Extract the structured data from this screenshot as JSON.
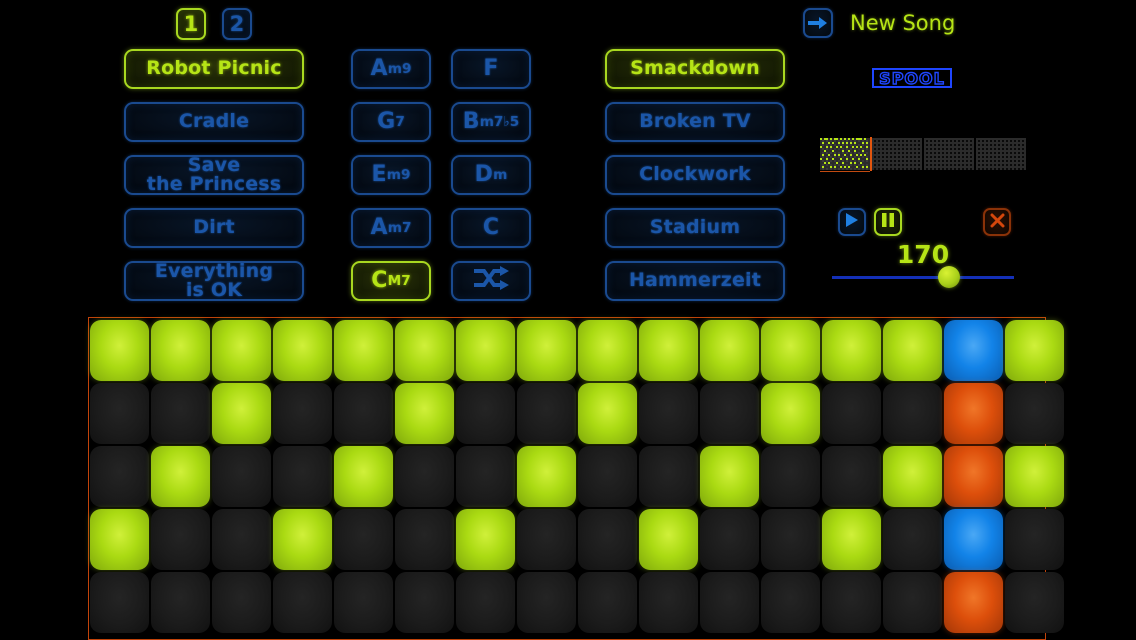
{
  "app": {
    "logo_text": "SPOOL"
  },
  "pages": {
    "items": [
      {
        "label": "1",
        "selected": true
      },
      {
        "label": "2",
        "selected": false
      }
    ]
  },
  "songs": {
    "items": [
      {
        "label": "Robot Picnic",
        "lines": [
          "Robot Picnic"
        ],
        "selected": true
      },
      {
        "label": "Cradle",
        "lines": [
          "Cradle"
        ],
        "selected": false
      },
      {
        "label": "Save the Princess",
        "lines": [
          "Save",
          "the Princess"
        ],
        "selected": false
      },
      {
        "label": "Dirt",
        "lines": [
          "Dirt"
        ],
        "selected": false
      },
      {
        "label": "Everything is OK",
        "lines": [
          "Everything",
          "is OK"
        ],
        "selected": false
      }
    ]
  },
  "chords": {
    "items": [
      {
        "root": "A",
        "ext": "m9",
        "selected": false
      },
      {
        "root": "F",
        "ext": "",
        "selected": false
      },
      {
        "root": "G",
        "ext": "7",
        "selected": false
      },
      {
        "root": "B",
        "ext": "m7♭5",
        "selected": false
      },
      {
        "root": "E",
        "ext": "m9",
        "selected": false
      },
      {
        "root": "D",
        "ext": "m",
        "selected": false
      },
      {
        "root": "A",
        "ext": "m7",
        "selected": false
      },
      {
        "root": "C",
        "ext": "",
        "selected": false
      },
      {
        "root": "C",
        "ext": "M7",
        "selected": true
      },
      {
        "root": "",
        "ext": "",
        "icon": "shuffle-icon",
        "selected": false
      }
    ]
  },
  "kits": {
    "items": [
      {
        "label": "Smackdown",
        "selected": true
      },
      {
        "label": "Broken TV",
        "selected": false
      },
      {
        "label": "Clockwork",
        "selected": false
      },
      {
        "label": "Stadium",
        "selected": false
      },
      {
        "label": "Hammerzeit",
        "selected": false
      }
    ]
  },
  "new_song": {
    "label": "New Song",
    "icon": "arrow-right-icon"
  },
  "transport": {
    "play": {
      "icon": "play-icon",
      "state": "off"
    },
    "pause": {
      "icon": "pause-icon",
      "state": "on"
    },
    "stop": {
      "icon": "close-x-icon",
      "state": "off"
    },
    "tempo": {
      "value": "170",
      "slider_percent": 59
    }
  },
  "minimap": {
    "segments": 4,
    "active_segment": 1,
    "playhead_segment": 1
  },
  "sequencer": {
    "columns": 16,
    "rows": 5,
    "colors": {
      "green": "#aada12",
      "blue": "#1283e8",
      "orange": "#dd4f0b",
      "off": "#1b1b1b",
      "frame": "#c1430a"
    },
    "cells": [
      [
        "green",
        "green",
        "green",
        "green",
        "green",
        "green",
        "green",
        "green",
        "green",
        "green",
        "green",
        "green",
        "green",
        "green",
        "blue",
        "green"
      ],
      [
        "off",
        "off",
        "green",
        "off",
        "off",
        "green",
        "off",
        "off",
        "green",
        "off",
        "off",
        "green",
        "off",
        "off",
        "orange",
        "off"
      ],
      [
        "off",
        "green",
        "off",
        "off",
        "green",
        "off",
        "off",
        "green",
        "off",
        "off",
        "green",
        "off",
        "off",
        "green",
        "orange",
        "green"
      ],
      [
        "green",
        "off",
        "off",
        "green",
        "off",
        "off",
        "green",
        "off",
        "off",
        "green",
        "off",
        "off",
        "green",
        "off",
        "blue",
        "off"
      ],
      [
        "off",
        "off",
        "off",
        "off",
        "off",
        "off",
        "off",
        "off",
        "off",
        "off",
        "off",
        "off",
        "off",
        "off",
        "orange",
        "off"
      ]
    ]
  }
}
